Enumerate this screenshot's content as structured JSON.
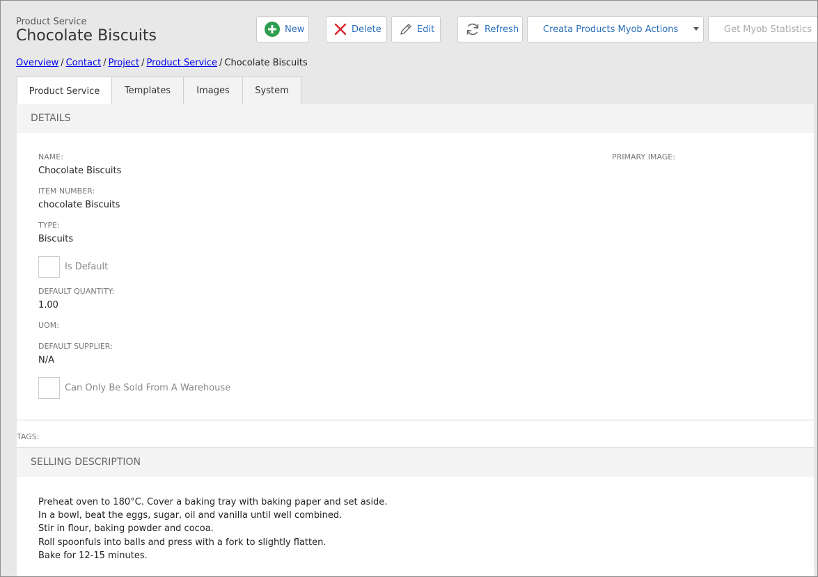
{
  "header": {
    "subtitle": "Product Service",
    "title": "Chocolate Biscuits"
  },
  "toolbar": {
    "new_label": "New",
    "delete_label": "Delete",
    "edit_label": "Edit",
    "refresh_label": "Refresh",
    "actions_label": "Creata Products Myob Actions",
    "statistics_label": "Get Myob Statistics"
  },
  "breadcrumb": {
    "items": [
      "Overview",
      "Contact",
      "Project",
      "Product Service"
    ],
    "current": "Chocolate Biscuits",
    "separator": "/"
  },
  "tabs": [
    "Product Service",
    "Templates",
    "Images",
    "System"
  ],
  "details": {
    "header": "DETAILS",
    "name_label": "NAME:",
    "name_value": "Chocolate Biscuits",
    "item_number_label": "ITEM NUMBER:",
    "item_number_value": "chocolate Biscuits",
    "type_label": "TYPE:",
    "type_value": "Biscuits",
    "is_default_label": "Is Default",
    "is_default_checked": false,
    "default_quantity_label": "DEFAULT QUANTITY:",
    "default_quantity_value": "1.00",
    "uom_label": "UOM:",
    "default_supplier_label": "DEFAULT SUPPLIER:",
    "default_supplier_value": "N/A",
    "warehouse_label": "Can Only Be Sold From A Warehouse",
    "warehouse_checked": false,
    "primary_image_label": "PRIMARY IMAGE:"
  },
  "tags": {
    "label": "TAGS:"
  },
  "selling_description": {
    "header": "SELLING DESCRIPTION",
    "lines": [
      "Preheat oven to 180°C. Cover a baking tray with baking paper and set aside.",
      "In a bowl, beat the eggs, sugar, oil and vanilla until well combined.",
      "Stir in flour, baking powder and cocoa.",
      "Roll spoonfuls into balls and press with a fork to slightly flatten.",
      "Bake for 12-15 minutes."
    ]
  },
  "colors": {
    "accent_link": "#2a6ebb",
    "new_icon": "#2e9e4f",
    "delete_icon": "#d9262c",
    "background": "#e8e8e8"
  },
  "icons": {
    "new": "plus-circle-icon",
    "delete": "x-icon",
    "edit": "pencil-icon",
    "refresh": "refresh-icon",
    "dropdown": "caret-down-icon"
  }
}
